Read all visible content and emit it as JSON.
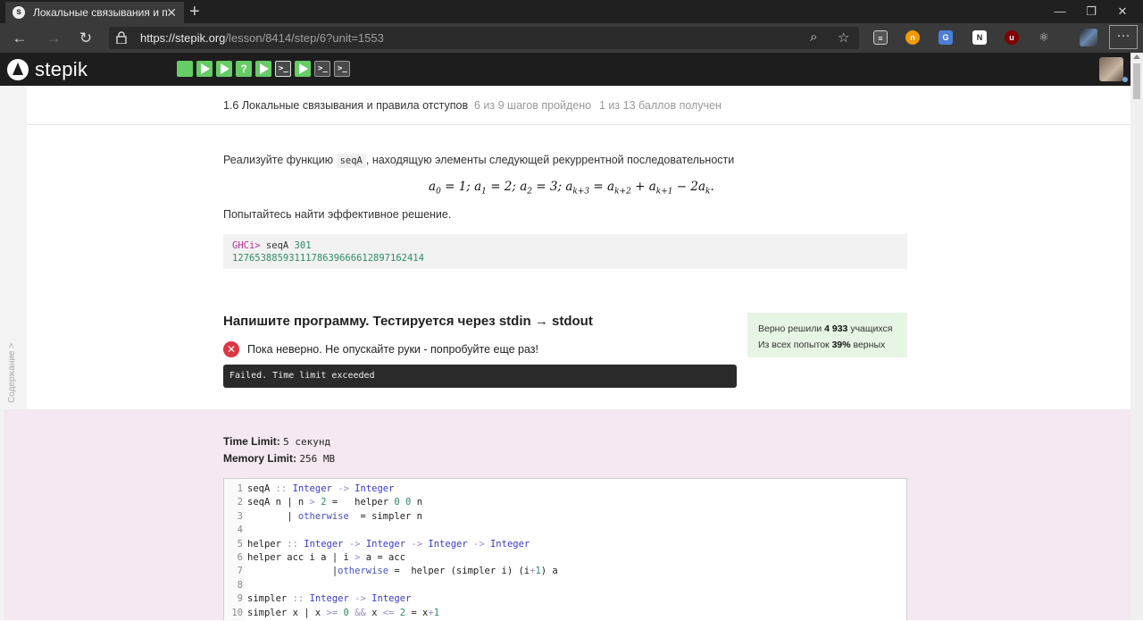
{
  "browser": {
    "tab_title": "Локальные связывания и прави",
    "tab_close": "✕",
    "new_tab": "+",
    "url_host": "https://stepik.org",
    "url_path": "/lesson/8414/step/6?unit=1553",
    "minimize": "—",
    "maximize": "❐",
    "close": "✕",
    "more": "···"
  },
  "header": {
    "logo_text": "stepik",
    "steps": [
      {
        "kind": "done-text",
        "label": ""
      },
      {
        "kind": "done-play",
        "label": ""
      },
      {
        "kind": "done-play",
        "label": ""
      },
      {
        "kind": "done-quiz",
        "label": "?"
      },
      {
        "kind": "done-play",
        "label": ""
      },
      {
        "kind": "current-code",
        "label": ">_"
      },
      {
        "kind": "done-play",
        "label": ""
      },
      {
        "kind": "code",
        "label": ">_"
      },
      {
        "kind": "code",
        "label": ">_"
      }
    ]
  },
  "sidebar": {
    "toc_label": "Содержание >"
  },
  "lesson": {
    "title": "1.6 Локальные связывания и правила отступов",
    "steps_progress": "6 из 9 шагов пройдено",
    "score": "1 из 13 баллов  получен"
  },
  "task": {
    "intro_before": "Реализуйте функцию",
    "func_name": "seqA",
    "intro_after": ", находящую элементы следующей рекуррентной последовательности",
    "hint": "Попытайтесь найти эффективное решение.",
    "ghci_prompt": "GHCi>",
    "ghci_cmd": " seqA ",
    "ghci_arg": "301",
    "ghci_output": "1276538859311178639666612897162414"
  },
  "submission": {
    "heading": "Напишите программу. Тестируется через stdin → stdout",
    "error_message": "Пока неверно. Не опускайте руки - попробуйте еще раз!",
    "fail_output": "Failed. Time limit exceeded",
    "stats_solved_prefix": "Верно решили ",
    "stats_solved_count": "4 933",
    "stats_solved_suffix": " учащихся",
    "stats_attempts_prefix": "Из всех попыток ",
    "stats_attempts_pct": "39%",
    "stats_attempts_suffix": " верных",
    "time_limit_label": "Time Limit:",
    "time_limit_value": "5 секунд",
    "memory_limit_label": "Memory Limit:",
    "memory_limit_value": "256 MB"
  },
  "code_lines": [
    "seqA :: Integer -> Integer",
    "seqA n | n > 2 =   helper 0 0 n",
    "       | otherwise  = simpler n",
    "",
    "helper :: Integer -> Integer -> Integer -> Integer",
    "helper acc i a | i > a = acc",
    "               |otherwise =  helper (simpler i) (i+1) a",
    "",
    "simpler :: Integer -> Integer",
    "simpler x | x >= 0 && x <= 2 = x+1"
  ],
  "colors": {
    "accent_green": "#66cc66",
    "error_red": "#dc3545",
    "stats_bg": "#e7f5e4",
    "code_section_bg": "#f4e9f3"
  }
}
